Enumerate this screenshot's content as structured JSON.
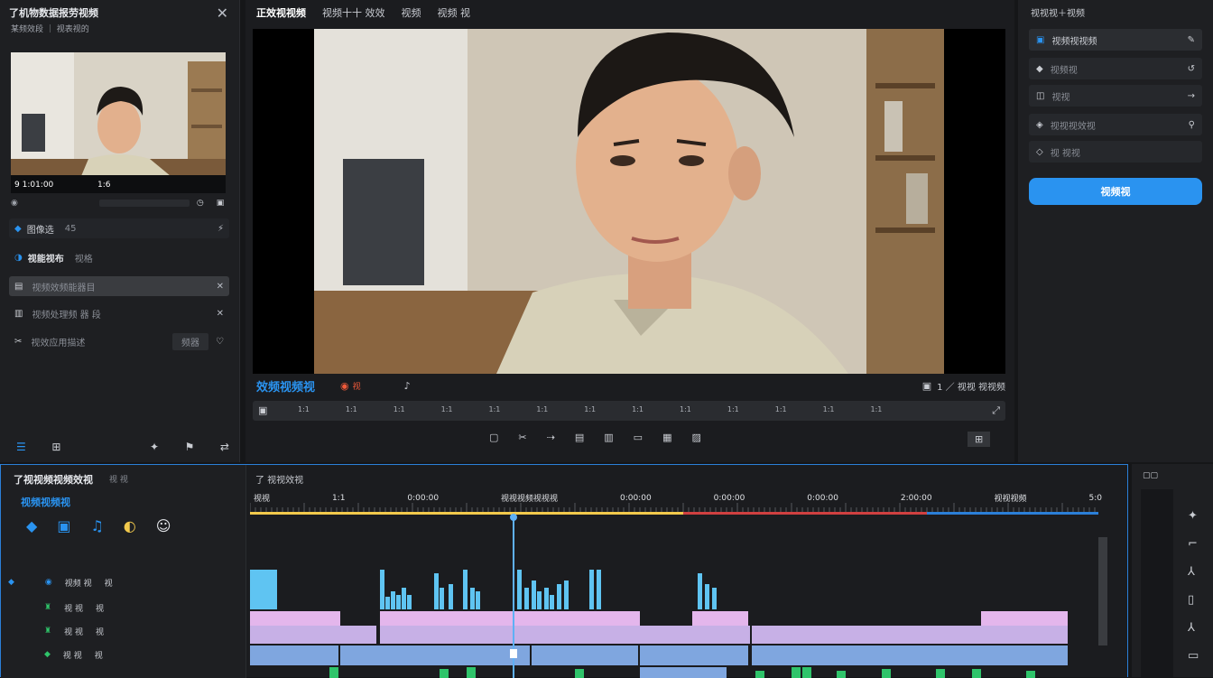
{
  "left_panel": {
    "title": "了机物数据报劳视频",
    "subtitle": "某频效段 ｜ 视表视的",
    "clip_time": "9 1:01:00",
    "clip_badge": "1:6",
    "row1_label": "图像选",
    "row1_value": "45",
    "row2_label": "视能视布",
    "row2_value": "视格",
    "items": [
      {
        "label": "视频效频能器目",
        "icon": "film-icon"
      },
      {
        "label": "视频处理频 器 段",
        "icon": "clip-icon"
      },
      {
        "label": "视效应用描述",
        "value": "频器",
        "icon": "scissors-icon"
      }
    ]
  },
  "viewer": {
    "tabs": [
      "正效视视频",
      "视频十十 效效",
      "视频",
      "视频 视"
    ],
    "overlay_title": "效频视频视",
    "rec_label": "视",
    "timecode_right": "1 ／ 视视 视视频",
    "scrub_marks": [
      "1:1",
      "1:1",
      "1:1",
      "1:1",
      "1:1",
      "1:1",
      "1:1",
      "1:1",
      "1:1",
      "1:1",
      "1:1",
      "1:1",
      "1:1"
    ]
  },
  "right_panel": {
    "header": "视视视＋视频",
    "rows": [
      {
        "label": "视频视视频",
        "icon": "screen-icon"
      },
      {
        "label": "视频视",
        "icon": "drop-icon"
      },
      {
        "label": "视视",
        "icon": "layers-icon"
      },
      {
        "label": "视视视效视",
        "icon": "shield-icon"
      },
      {
        "label": "视 视视",
        "icon": "tag-icon"
      }
    ],
    "export_label": "视频视"
  },
  "timeline": {
    "title": "了视视频视频效视",
    "badge": "视 视",
    "mode_label": "视频视频视",
    "track_header": "了 视视效视",
    "ruler_labels": [
      "视视",
      "1:1",
      "0:00:00",
      "视视视频视视视",
      "0:00:00",
      "0:00:00",
      "0:00:00",
      "2:00:00",
      "视视视频",
      "5:0"
    ],
    "tracks": [
      {
        "name": "视频 视",
        "n": "视"
      },
      {
        "name": "视 视",
        "n": "视"
      },
      {
        "name": "视 视",
        "n": "视"
      },
      {
        "name": "视 视",
        "n": "视"
      }
    ]
  },
  "colors": {
    "accent": "#2a93f0",
    "timeline_border": "#2b7fd8",
    "clip_pink": "#e4b6ec",
    "clip_blue": "#7fa6df",
    "audio_cyan": "#5fc4f2",
    "audio_green": "#2fc46a"
  }
}
